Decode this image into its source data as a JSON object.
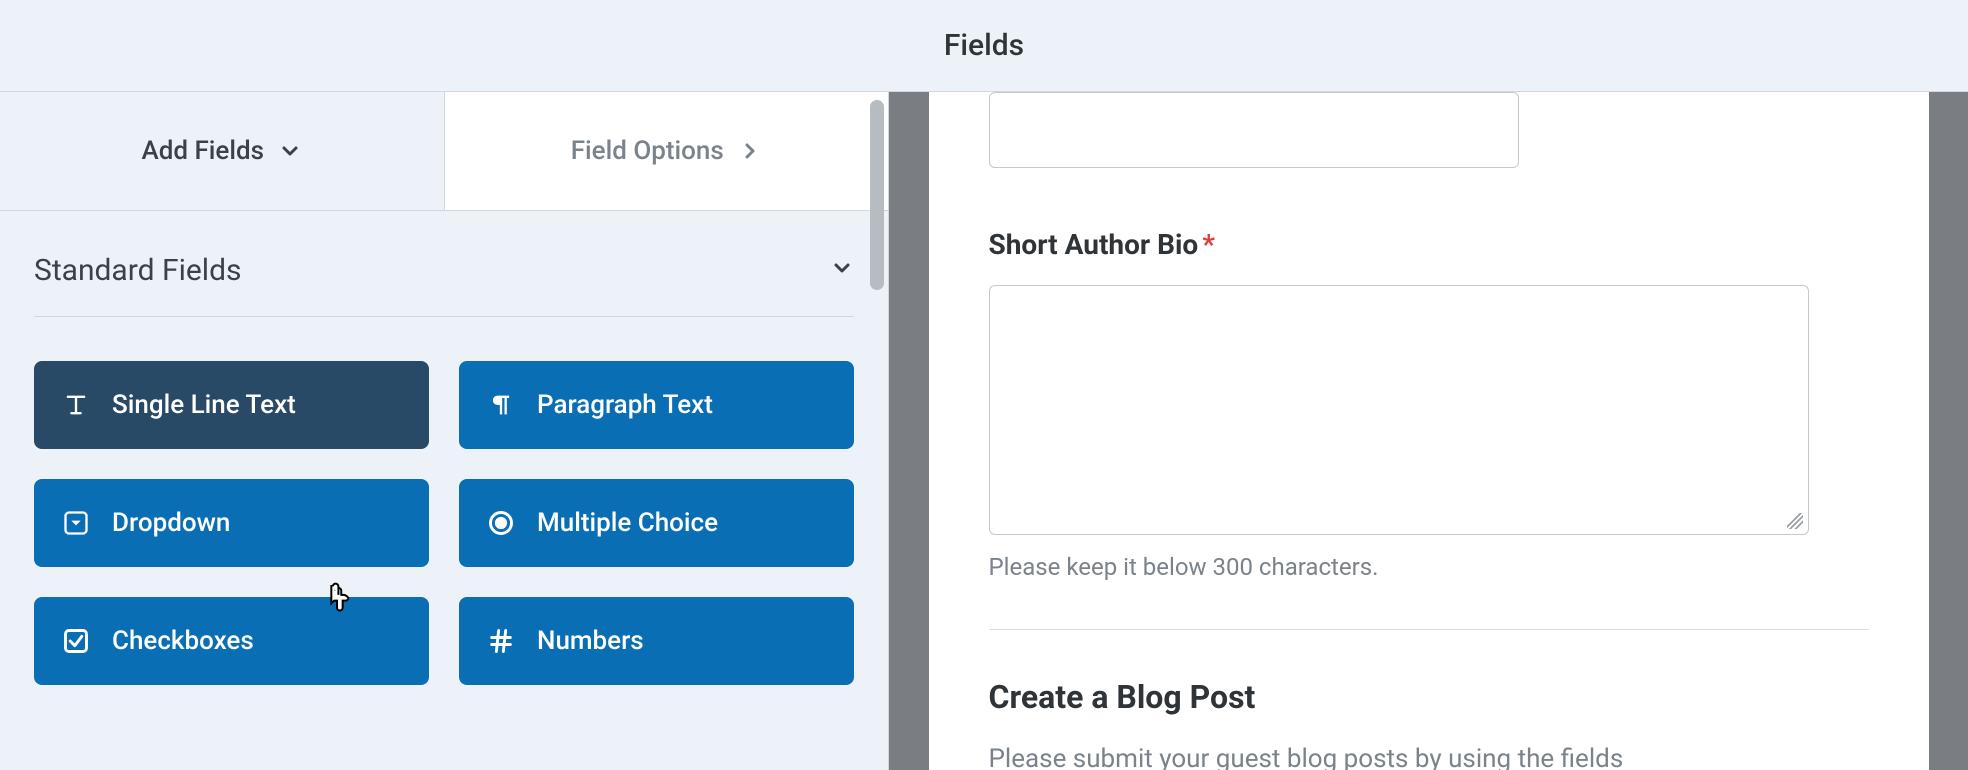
{
  "topbar": {
    "title": "Fields"
  },
  "tabs": {
    "add_fields": "Add Fields",
    "field_options": "Field Options"
  },
  "sidebar": {
    "section_title": "Standard Fields",
    "buttons": {
      "single_line_text": "Single Line Text",
      "paragraph_text": "Paragraph Text",
      "dropdown": "Dropdown",
      "multiple_choice": "Multiple Choice",
      "checkboxes": "Checkboxes",
      "numbers": "Numbers"
    }
  },
  "preview": {
    "bio_label": "Short Author Bio",
    "bio_helper": "Please keep it below 300 characters.",
    "blog_title": "Create a Blog Post",
    "blog_desc": "Please submit your guest blog posts by using the fields"
  }
}
